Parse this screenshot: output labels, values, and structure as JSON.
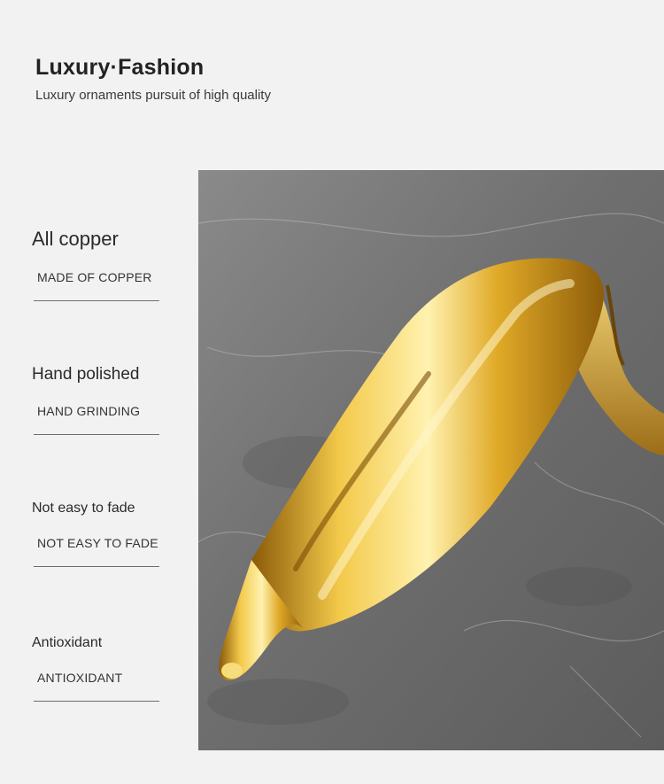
{
  "header": {
    "title": "Luxury·Fashion",
    "subtitle": "Luxury ornaments pursuit of high quality"
  },
  "features": [
    {
      "title": "All copper",
      "caption": "MADE OF COPPER"
    },
    {
      "title": "Hand polished",
      "caption": "HAND GRINDING"
    },
    {
      "title": "Not easy to fade",
      "caption": "NOT EASY TO FADE"
    },
    {
      "title": "Antioxidant",
      "caption": "ANTIOXIDANT"
    }
  ],
  "colors": {
    "background": "#f2f2f2",
    "marble": "#7d7d7d",
    "gold": "#d4a21c"
  }
}
